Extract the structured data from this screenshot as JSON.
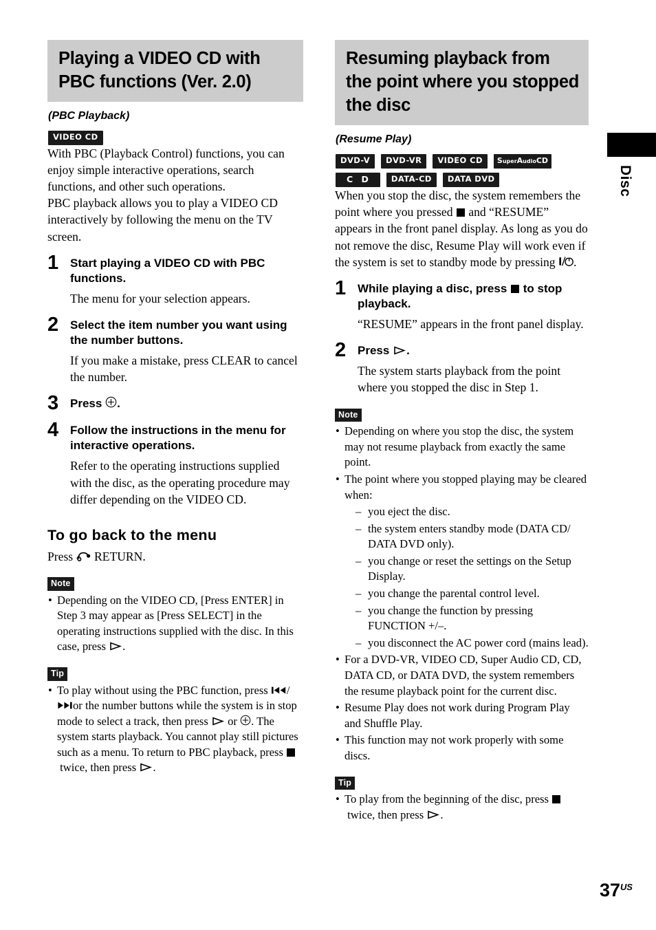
{
  "page": {
    "number": "37",
    "region_suffix": "US",
    "side_tab_label": "Disc"
  },
  "left_column": {
    "heading": "Playing a VIDEO CD with PBC functions (Ver. 2.0)",
    "subheading": "(PBC Playback)",
    "badges": [
      {
        "id": "video-cd",
        "label": "VIDEO CD"
      }
    ],
    "intro_paragraph_1": "With PBC (Playback Control) functions, you can enjoy simple interactive operations, search functions, and other such operations.",
    "intro_paragraph_2": "PBC playback allows you to play a VIDEO CD interactively by following the menu on the TV screen.",
    "steps": [
      {
        "number": "1",
        "title": "Start playing a VIDEO CD with PBC functions.",
        "description": "The menu for your selection appears."
      },
      {
        "number": "2",
        "title": "Select the item number you want using the number buttons.",
        "description": "If you make a mistake, press CLEAR to cancel the number."
      },
      {
        "number": "3",
        "title_prefix": "Press",
        "title_icon": "enter-button-icon",
        "title_suffix": ".",
        "description": ""
      },
      {
        "number": "4",
        "title": "Follow the instructions in the menu for interactive operations.",
        "description": "Refer to the operating instructions supplied with the disc, as the operating procedure may differ depending on the VIDEO CD."
      }
    ],
    "minor_heading": "To go back to the menu",
    "minor_text_prefix": "Press",
    "minor_text_icon": "return-button-icon",
    "minor_text_suffix": "RETURN.",
    "note": {
      "tag": "Note",
      "items": [
        {
          "text_before": "Depending on the VIDEO CD, [Press ENTER] in Step 3 may appear as [Press SELECT] in the operating instructions supplied with the disc. In this case, press",
          "icon": "play-button-icon",
          "text_after": "."
        }
      ]
    },
    "tip": {
      "tag": "Tip",
      "items": [
        {
          "text_1": "To play without using the PBC function, press",
          "icon_1": "previous-track-icon",
          "text_2": "/",
          "icon_2": "next-track-icon",
          "text_3": "or the number buttons while the system is in stop mode to select a track, then press",
          "icon_3": "play-button-icon",
          "text_4": "or",
          "icon_4": "enter-button-icon",
          "text_5": ". The system starts playback. You cannot play still pictures such as a menu. To return to PBC playback, press",
          "icon_5": "stop-button-icon",
          "text_6": "twice, then press",
          "icon_6": "play-button-icon",
          "text_7": "."
        }
      ]
    }
  },
  "right_column": {
    "heading": "Resuming playback from the point where you stopped the disc",
    "subheading": "(Resume Play)",
    "badges": [
      {
        "id": "dvd-v",
        "label": "DVD-V"
      },
      {
        "id": "dvd-vr",
        "label": "DVD-VR"
      },
      {
        "id": "video-cd",
        "label": "VIDEO CD"
      },
      {
        "id": "super-audio-cd",
        "label_a": "S",
        "label_b": "uper",
        "label_c": "A",
        "label_d": "udio",
        "label_e": "CD"
      },
      {
        "id": "cd",
        "label": "C D"
      },
      {
        "id": "data-cd",
        "label": "DATA-CD"
      },
      {
        "id": "data-dvd",
        "label": "DATA DVD"
      }
    ],
    "intro": {
      "text_1": "When you stop the disc, the system remembers the point where you pressed",
      "icon_1": "stop-button-icon",
      "text_2": "and “RESUME” appears in the front panel display. As long as you do not remove the disc, Resume Play will work even if the system is set to standby mode by pressing",
      "icon_2": "power-button-icon",
      "text_3": "."
    },
    "steps": [
      {
        "number": "1",
        "title_prefix": "While playing a disc, press",
        "title_icon": "stop-button-icon",
        "title_suffix": "to stop playback.",
        "description": "“RESUME” appears in the front panel display."
      },
      {
        "number": "2",
        "title_prefix": "Press",
        "title_icon": "play-button-icon",
        "title_suffix": ".",
        "description": "The system starts playback from the point where you stopped the disc in Step 1."
      }
    ],
    "note": {
      "tag": "Note",
      "item_1": "Depending on where you stop the disc, the system may not resume playback from exactly the same point.",
      "item_2": "The point where you stopped playing may be cleared when:",
      "sub_items": [
        "you eject the disc.",
        "the system enters standby mode (DATA CD/ DATA DVD only).",
        "you change or reset the settings on the Setup Display.",
        "you change the parental control level.",
        "you change the function by pressing FUNCTION +/–.",
        "you disconnect the AC power cord (mains lead)."
      ],
      "item_3": "For a DVD-VR, VIDEO CD, Super Audio CD, CD, DATA CD, or DATA DVD, the system remembers the resume playback point for the current disc.",
      "item_4": "Resume Play does not work during Program Play and Shuffle Play.",
      "item_5": "This function may not work properly with some discs."
    },
    "tip": {
      "tag": "Tip",
      "item": {
        "text_1": "To play from the beginning of the disc, press",
        "icon_1": "stop-button-icon",
        "text_2": "twice, then press",
        "icon_2": "play-button-icon",
        "text_3": "."
      }
    }
  },
  "colors": {
    "heading_band": "#cccccc",
    "badge_background": "#1a1a1a",
    "text": "#000000",
    "page_background": "#ffffff"
  }
}
